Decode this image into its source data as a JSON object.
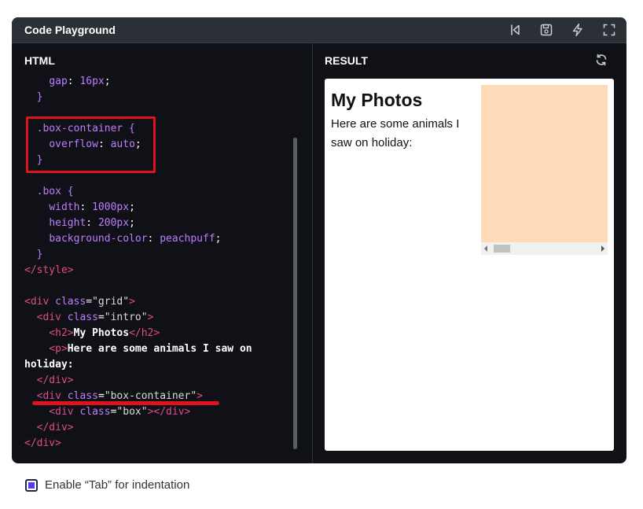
{
  "window": {
    "title": "Code Playground"
  },
  "toolbar": {
    "icons": [
      "restart-icon",
      "save-icon",
      "lightning-icon",
      "fullscreen-icon"
    ]
  },
  "editor": {
    "label": "HTML",
    "lines": [
      [
        {
          "t": "    ",
          "c": "plain"
        },
        {
          "t": "gap",
          "c": "prop"
        },
        {
          "t": ": ",
          "c": "plain"
        },
        {
          "t": "16px",
          "c": "prop"
        },
        {
          "t": ";",
          "c": "plain"
        }
      ],
      [
        {
          "t": "  }",
          "c": "sel"
        }
      ],
      [
        {
          "t": "",
          "c": "plain"
        }
      ],
      [
        {
          "t": "  .box-container {",
          "c": "sel"
        }
      ],
      [
        {
          "t": "    ",
          "c": "plain"
        },
        {
          "t": "overflow",
          "c": "prop"
        },
        {
          "t": ": ",
          "c": "plain"
        },
        {
          "t": "auto",
          "c": "prop"
        },
        {
          "t": ";",
          "c": "plain"
        }
      ],
      [
        {
          "t": "  }",
          "c": "sel"
        }
      ],
      [
        {
          "t": "",
          "c": "plain"
        }
      ],
      [
        {
          "t": "  .box {",
          "c": "sel"
        }
      ],
      [
        {
          "t": "    ",
          "c": "plain"
        },
        {
          "t": "width",
          "c": "prop"
        },
        {
          "t": ": ",
          "c": "plain"
        },
        {
          "t": "1000px",
          "c": "prop"
        },
        {
          "t": ";",
          "c": "plain"
        }
      ],
      [
        {
          "t": "    ",
          "c": "plain"
        },
        {
          "t": "height",
          "c": "prop"
        },
        {
          "t": ": ",
          "c": "plain"
        },
        {
          "t": "200px",
          "c": "prop"
        },
        {
          "t": ";",
          "c": "plain"
        }
      ],
      [
        {
          "t": "    ",
          "c": "plain"
        },
        {
          "t": "background-color",
          "c": "prop"
        },
        {
          "t": ": ",
          "c": "plain"
        },
        {
          "t": "peachpuff",
          "c": "prop"
        },
        {
          "t": ";",
          "c": "plain"
        }
      ],
      [
        {
          "t": "  }",
          "c": "sel"
        }
      ],
      [
        {
          "t": "</style>",
          "c": "tag"
        }
      ],
      [
        {
          "t": "",
          "c": "plain"
        }
      ],
      [
        {
          "t": "<div ",
          "c": "tag"
        },
        {
          "t": "class",
          "c": "attr"
        },
        {
          "t": "=",
          "c": "plain"
        },
        {
          "t": "\"grid\"",
          "c": "str"
        },
        {
          "t": ">",
          "c": "tag"
        }
      ],
      [
        {
          "t": "  <div ",
          "c": "tag"
        },
        {
          "t": "class",
          "c": "attr"
        },
        {
          "t": "=",
          "c": "plain"
        },
        {
          "t": "\"intro\"",
          "c": "str"
        },
        {
          "t": ">",
          "c": "tag"
        }
      ],
      [
        {
          "t": "    <h2>",
          "c": "tag"
        },
        {
          "t": "My Photos",
          "c": "bold"
        },
        {
          "t": "</h2>",
          "c": "tag"
        }
      ],
      [
        {
          "t": "    <p>",
          "c": "tag"
        },
        {
          "t": "Here are some animals I saw on",
          "c": "bold"
        }
      ],
      [
        {
          "t": "holiday:",
          "c": "bold"
        }
      ],
      [
        {
          "t": "  </div>",
          "c": "tag"
        }
      ],
      [
        {
          "t": "  <div ",
          "c": "tag"
        },
        {
          "t": "class",
          "c": "attr"
        },
        {
          "t": "=",
          "c": "plain"
        },
        {
          "t": "\"box-container\"",
          "c": "str"
        },
        {
          "t": ">",
          "c": "tag"
        }
      ],
      [
        {
          "t": "    <div ",
          "c": "tag"
        },
        {
          "t": "class",
          "c": "attr"
        },
        {
          "t": "=",
          "c": "plain"
        },
        {
          "t": "\"box\"",
          "c": "str"
        },
        {
          "t": "></div>",
          "c": "tag"
        }
      ],
      [
        {
          "t": "  </div>",
          "c": "tag"
        }
      ],
      [
        {
          "t": "</div>",
          "c": "tag"
        }
      ]
    ]
  },
  "result": {
    "label": "RESULT",
    "heading": "My Photos",
    "paragraph": "Here are some animals I saw on holiday:",
    "box_color": "#ffdab9"
  },
  "options": {
    "tab_indent_label": "Enable “Tab” for indentation",
    "tab_indent_checked": true
  },
  "colors": {
    "annotation_red": "#e0121c",
    "checkbox_accent": "#5b38ed"
  }
}
